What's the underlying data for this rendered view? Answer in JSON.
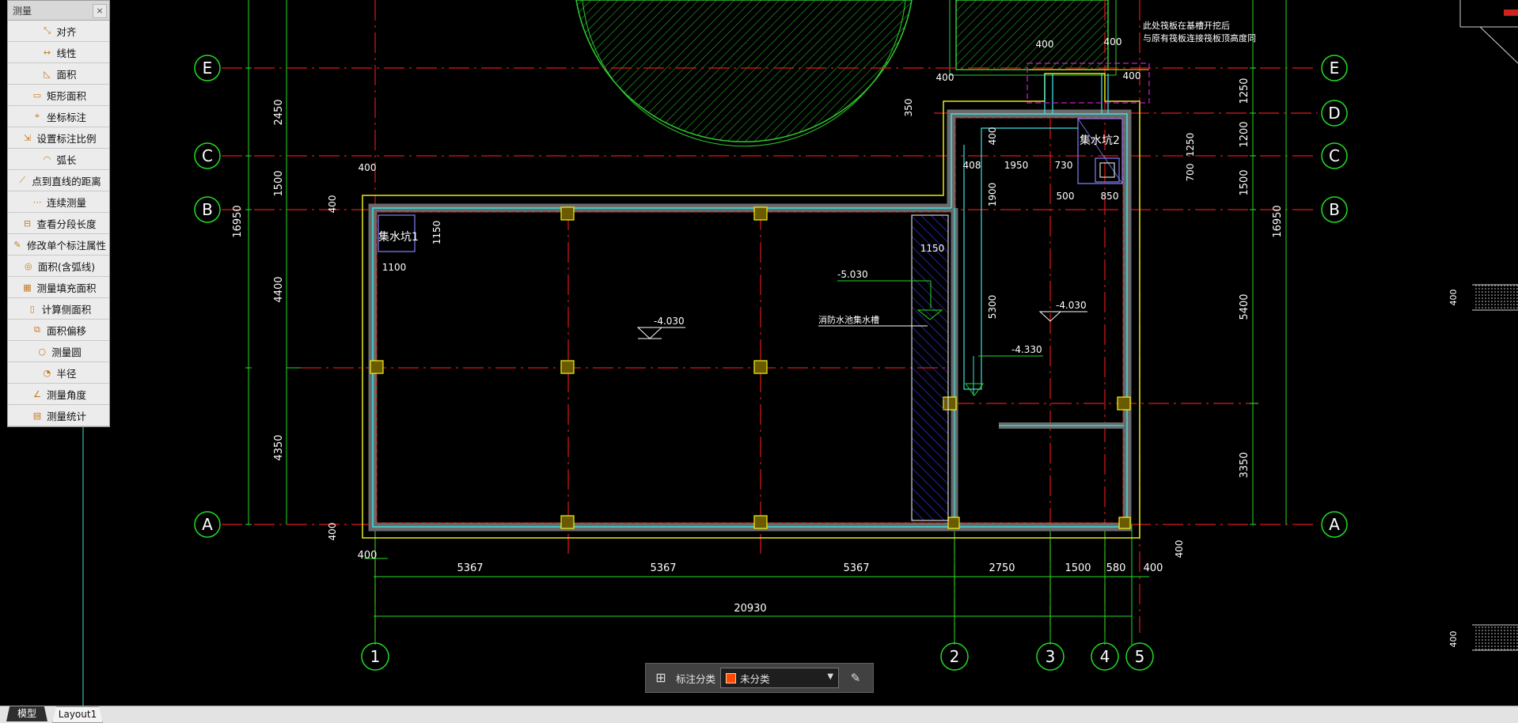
{
  "palette": {
    "title": "测量",
    "close": "×",
    "items": [
      {
        "label": "对齐",
        "icon": "align-dim-icon"
      },
      {
        "label": "线性",
        "icon": "linear-dim-icon"
      },
      {
        "label": "面积",
        "icon": "area-icon"
      },
      {
        "label": "矩形面积",
        "icon": "rect-area-icon"
      },
      {
        "label": "坐标标注",
        "icon": "coordinate-icon"
      },
      {
        "label": "设置标注比例",
        "icon": "scale-icon"
      },
      {
        "label": "弧长",
        "icon": "arc-length-icon"
      },
      {
        "label": "点到直线的距离",
        "icon": "point-line-icon"
      },
      {
        "label": "连续测量",
        "icon": "continuous-icon"
      },
      {
        "label": "查看分段长度",
        "icon": "segment-icon"
      },
      {
        "label": "修改单个标注属性",
        "icon": "edit-dim-icon"
      },
      {
        "label": "面积(含弧线)",
        "icon": "arc-area-icon"
      },
      {
        "label": "测量填充面积",
        "icon": "hatch-area-icon"
      },
      {
        "label": "计算侧面积",
        "icon": "side-area-icon"
      },
      {
        "label": "面积偏移",
        "icon": "area-offset-icon"
      },
      {
        "label": "测量圆",
        "icon": "circle-icon"
      },
      {
        "label": "半径",
        "icon": "radius-icon"
      },
      {
        "label": "测量角度",
        "icon": "angle-icon"
      },
      {
        "label": "测量统计",
        "icon": "statistics-icon"
      }
    ]
  },
  "cmdbar": {
    "label": "标注分类",
    "selected": "未分类",
    "swatch_color": "#ff4a00"
  },
  "tabs": {
    "model": "模型",
    "layout1": "Layout1"
  },
  "drawing": {
    "grid_rows": [
      "E",
      "D",
      "C",
      "B",
      "A"
    ],
    "grid_cols": [
      "1",
      "2",
      "3",
      "4",
      "5"
    ],
    "bottom_dims": [
      "400",
      "5367",
      "5367",
      "5367",
      "2750",
      "1500",
      "580",
      "400"
    ],
    "total_dim": "20930",
    "left_dims": [
      "2450",
      "1500",
      "4400",
      "4350"
    ],
    "left_total": "16950",
    "right_dims": [
      "1250",
      "1200",
      "1500",
      "5400",
      "3350"
    ],
    "right_total": "16950",
    "small_dims": [
      "400",
      "400",
      "400",
      "400",
      "350",
      "400",
      "400",
      "1150",
      "1100",
      "1150",
      "408",
      "1950",
      "730",
      "400",
      "1900",
      "5300",
      "500",
      "850",
      "1250",
      "700",
      "400",
      "400"
    ],
    "sump1": "集水坑1",
    "sump2": "集水坑2",
    "elevations": [
      "-4.030",
      "-5.030",
      "-4.030",
      "-4.330"
    ],
    "pool_label": "消防水池集水槽",
    "note": "此处筏板在基槽开挖后\n与原有筏板连接筏板顶高度同"
  }
}
